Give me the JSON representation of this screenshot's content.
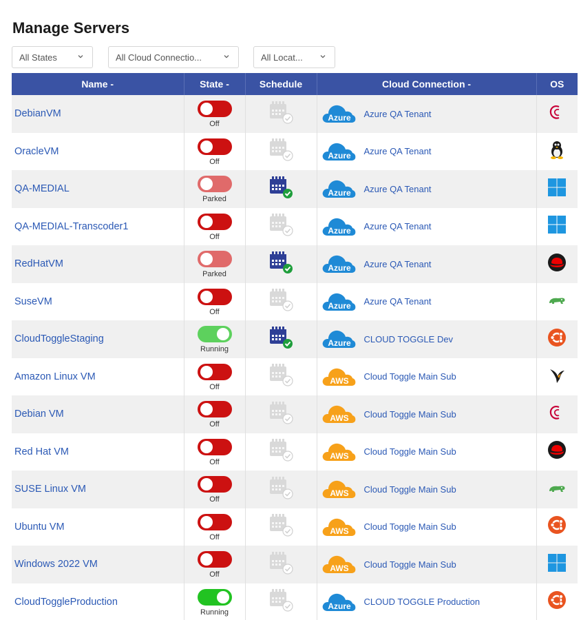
{
  "page": {
    "title": "Manage Servers"
  },
  "filters": {
    "states": "All States",
    "cloud_connections": "All Cloud Connectio...",
    "locations": "All Locat..."
  },
  "table": {
    "columns": [
      "Name -",
      "State -",
      "Schedule",
      "Cloud Connection -",
      "OS"
    ],
    "rows": [
      {
        "name": "DebianVM",
        "state": "Off",
        "schedule": false,
        "provider": "Azure",
        "connection": "Azure QA Tenant",
        "os": "debian"
      },
      {
        "name": "OracleVM",
        "state": "Off",
        "schedule": false,
        "provider": "Azure",
        "connection": "Azure QA Tenant",
        "os": "linux"
      },
      {
        "name": "QA-MEDIAL",
        "state": "Parked",
        "schedule": true,
        "provider": "Azure",
        "connection": "Azure QA Tenant",
        "os": "windows"
      },
      {
        "name": "QA-MEDIAL-Transcoder1",
        "state": "Off",
        "schedule": false,
        "provider": "Azure",
        "connection": "Azure QA Tenant",
        "os": "windows"
      },
      {
        "name": "RedHatVM",
        "state": "Parked",
        "schedule": true,
        "provider": "Azure",
        "connection": "Azure QA Tenant",
        "os": "redhat"
      },
      {
        "name": "SuseVM",
        "state": "Off",
        "schedule": false,
        "provider": "Azure",
        "connection": "Azure QA Tenant",
        "os": "suse"
      },
      {
        "name": "CloudToggleStaging",
        "state": "Running",
        "schedule": true,
        "provider": "Azure",
        "connection": "CLOUD TOGGLE Dev",
        "os": "ubuntu"
      },
      {
        "name": "Amazon Linux VM",
        "state": "Off",
        "schedule": false,
        "provider": "AWS",
        "connection": "Cloud Toggle Main Sub",
        "os": "amazon-linux"
      },
      {
        "name": "Debian VM",
        "state": "Off",
        "schedule": false,
        "provider": "AWS",
        "connection": "Cloud Toggle Main Sub",
        "os": "debian"
      },
      {
        "name": "Red Hat VM",
        "state": "Off",
        "schedule": false,
        "provider": "AWS",
        "connection": "Cloud Toggle Main Sub",
        "os": "redhat"
      },
      {
        "name": "SUSE Linux VM",
        "state": "Off",
        "schedule": false,
        "provider": "AWS",
        "connection": "Cloud Toggle Main Sub",
        "os": "suse"
      },
      {
        "name": "Ubuntu VM",
        "state": "Off",
        "schedule": false,
        "provider": "AWS",
        "connection": "Cloud Toggle Main Sub",
        "os": "ubuntu"
      },
      {
        "name": "Windows 2022 VM",
        "state": "Off",
        "schedule": false,
        "provider": "AWS",
        "connection": "Cloud Toggle Main Sub",
        "os": "windows"
      },
      {
        "name": "CloudToggleProduction",
        "state": "Running",
        "schedule": false,
        "provider": "Azure",
        "connection": "CLOUD TOGGLE Production",
        "os": "ubuntu"
      }
    ]
  },
  "colors": {
    "header_bg": "#3a53a4",
    "link": "#2b59b5",
    "toggle_off": "#cc1111",
    "toggle_parked": "#e06a6a",
    "toggle_running": "#5dd15d",
    "azure": "#1f8ad6",
    "aws": "#f7a11a"
  }
}
